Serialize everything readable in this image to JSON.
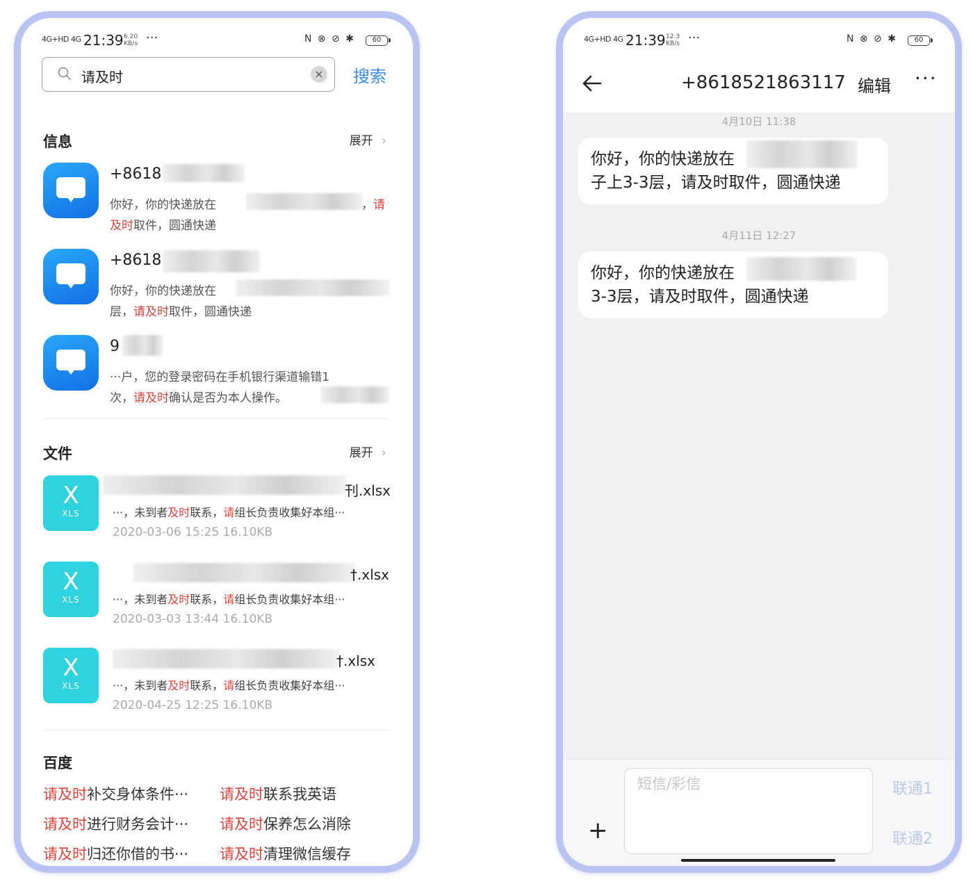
{
  "left": {
    "status": {
      "signal1": "4G+HD 4G",
      "time": "21:39",
      "speed": "6.20",
      "speed_unit": "KB/s",
      "dots": "···",
      "icons": "N ⊗ ⊘ ✱",
      "battery": "60"
    },
    "search": {
      "query": "请及时",
      "clear": "×",
      "button": "搜索"
    },
    "messages": {
      "title": "信息",
      "expand": "展开",
      "chevron": "›",
      "items": [
        {
          "title": "+8618",
          "l1": "你好，你的快递放在",
          "l1_end": "，",
          "l1_hl": "请",
          "l2_hl": "及时",
          "l2": "取件，圆通快递"
        },
        {
          "title": "+8618",
          "l1": "你好，你的快递放在",
          "l2_pre": "层，",
          "l2_hl": "请及时",
          "l2": "取件，圆通快递"
        },
        {
          "title": "9",
          "l1": "···户，您的登录密码在手机银行渠道输错1",
          "l2_pre": "次，",
          "l2_hl": "请及时",
          "l2": "确认是否为本人操作。"
        }
      ]
    },
    "files": {
      "title": "文件",
      "expand": "展开",
      "chevron": "›",
      "icon_letter": "X",
      "icon_label": "XLS",
      "items": [
        {
          "name_end": "刊.xlsx",
          "pre": "···，未到者",
          "hl1": "及时",
          "mid": "联系，",
          "hl2": "请",
          "post": "组长负责收集好本组···",
          "meta": "2020-03-06  15:25  16.10KB"
        },
        {
          "name_end": "†.xlsx",
          "pre": "···，未到者",
          "hl1": "及时",
          "mid": "联系，",
          "hl2": "请",
          "post": "组长负责收集好本组···",
          "meta": "2020-03-03  13:44  16.10KB"
        },
        {
          "name_end": "†.xlsx",
          "pre": "···，未到者",
          "hl1": "及时",
          "mid": "联系，",
          "hl2": "请",
          "post": "组长负责收集好本组···",
          "meta": "2020-04-25  12:25  16.10KB"
        }
      ]
    },
    "baidu": {
      "title": "百度",
      "items": [
        {
          "hl": "请及时",
          "rest": "补交身体条件···"
        },
        {
          "hl": "请及时",
          "rest": "联系我英语"
        },
        {
          "hl": "请及时",
          "rest": "进行财务会计···"
        },
        {
          "hl": "请及时",
          "rest": "保养怎么消除"
        },
        {
          "hl": "请及时",
          "rest": "归还你借的书···"
        },
        {
          "hl": "请及时",
          "rest": "清理微信缓存"
        }
      ]
    }
  },
  "right": {
    "status": {
      "signal1": "4G+HD 4G",
      "time": "21:39",
      "speed": "12.3",
      "speed_unit": "KB/s",
      "dots": "···",
      "icons": "N ⊗ ⊘ ✱",
      "battery": "60"
    },
    "header": {
      "back": "←",
      "title": "+8618521863117",
      "edit": "编辑",
      "more": "···"
    },
    "thread": [
      {
        "date": "4月10日 11:38",
        "l1": "你好，你的快递放在",
        "l2": "子上3-3层，请及时取件，圆通快递"
      },
      {
        "date": "4月11日 12:27",
        "l1": "你好，你的快递放在",
        "l2": "3-3层，请及时取件，圆通快递"
      }
    ],
    "input": {
      "plus": "+",
      "placeholder": "短信/彩信",
      "sim1": "联通1",
      "sim2": "联通2"
    }
  },
  "colors": {
    "frame": "#b9c4f3",
    "highlight": "#e0423a",
    "search_blue": "#3a8ee6",
    "msg_icon": "#1a8cf0",
    "xls_icon": "#2ed3dd"
  }
}
